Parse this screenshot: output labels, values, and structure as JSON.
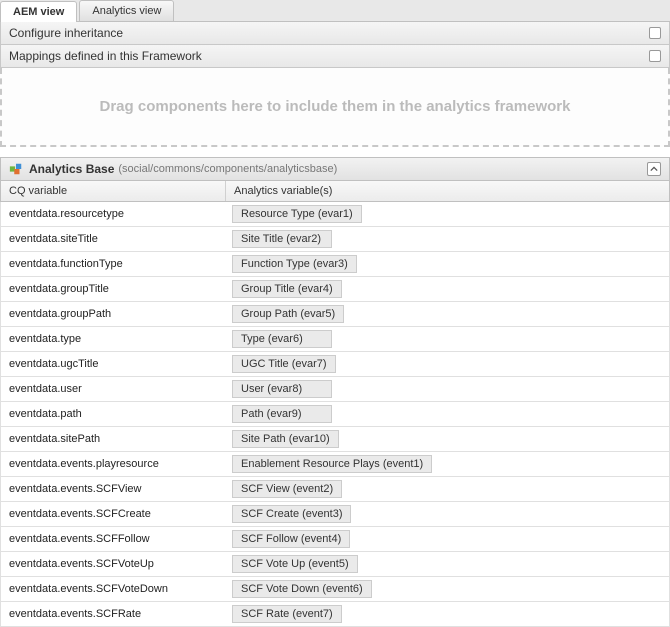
{
  "tabs": {
    "aem": "AEM view",
    "analytics": "Analytics view"
  },
  "accordion": {
    "configure_inheritance": "Configure inheritance",
    "mappings_defined": "Mappings defined in this Framework"
  },
  "dropzone": {
    "text": "Drag components here to include them in the analytics framework"
  },
  "panel": {
    "title": "Analytics Base",
    "path": "(social/commons/components/analyticsbase)"
  },
  "columns": {
    "cq": "CQ variable",
    "av": "Analytics variable(s)"
  },
  "rows": [
    {
      "cq": "eventdata.resourcetype",
      "av": "Resource Type (evar1)"
    },
    {
      "cq": "eventdata.siteTitle",
      "av": "Site Title (evar2)"
    },
    {
      "cq": "eventdata.functionType",
      "av": "Function Type (evar3)"
    },
    {
      "cq": "eventdata.groupTitle",
      "av": "Group Title (evar4)"
    },
    {
      "cq": "eventdata.groupPath",
      "av": "Group Path (evar5)"
    },
    {
      "cq": "eventdata.type",
      "av": "Type (evar6)"
    },
    {
      "cq": "eventdata.ugcTitle",
      "av": "UGC Title (evar7)"
    },
    {
      "cq": "eventdata.user",
      "av": "User (evar8)"
    },
    {
      "cq": "eventdata.path",
      "av": "Path (evar9)"
    },
    {
      "cq": "eventdata.sitePath",
      "av": "Site Path (evar10)"
    },
    {
      "cq": "eventdata.events.playresource",
      "av": "Enablement Resource Plays (event1)"
    },
    {
      "cq": "eventdata.events.SCFView",
      "av": "SCF View (event2)"
    },
    {
      "cq": "eventdata.events.SCFCreate",
      "av": "SCF Create (event3)"
    },
    {
      "cq": "eventdata.events.SCFFollow",
      "av": "SCF Follow (event4)"
    },
    {
      "cq": "eventdata.events.SCFVoteUp",
      "av": "SCF Vote Up (event5)"
    },
    {
      "cq": "eventdata.events.SCFVoteDown",
      "av": "SCF Vote Down (event6)"
    },
    {
      "cq": "eventdata.events.SCFRate",
      "av": "SCF Rate (event7)"
    }
  ]
}
